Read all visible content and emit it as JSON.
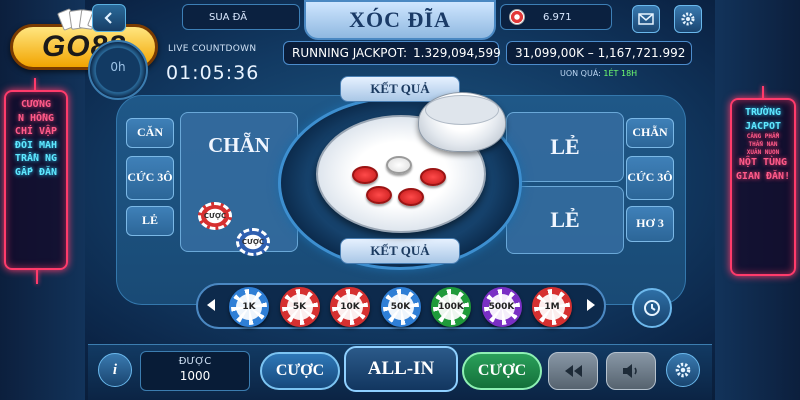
{
  "logo": {
    "text": "GO88"
  },
  "neon_left": {
    "lines": [
      "CƯƠNG",
      "N HỒNG",
      "CHÍ VẬP",
      "ĐÔI MAH",
      "TRẦN NG",
      "GẤP ĐĂN"
    ]
  },
  "neon_right": {
    "lines": [
      "TRƯỜNG",
      "JACPOT",
      "CĂNG PHẨM",
      "THẤN NAN",
      "XUÂN NUON",
      "NỘT TÙNG",
      "GIAN ĐĂN!"
    ]
  },
  "header": {
    "back_icon": "chevron-left-icon",
    "user_label": "SUA ĐÃ",
    "title": "XÓC ĐĨA",
    "balance": "6.971",
    "mail_icon": "mail-icon",
    "settings_icon": "gear-icon"
  },
  "countdown": {
    "ring_text": "0h",
    "label": "LIVE COUNTDOWN",
    "time": "01:05:36"
  },
  "jackpot": {
    "running_label": "RUNNING JACKPOT:",
    "running_value": "1.329,094,599",
    "second_value": "31,099,00K – 1,167,721.992",
    "uon_label": "UON QUÁ:",
    "uon_value": "1ÉT 18H"
  },
  "table": {
    "left_main": "CHẴN",
    "right_main_top": "LẺ",
    "right_main_bottom": "LẺ",
    "left_cells": [
      "CĂN",
      "CỨC 3Ô",
      "LẺ"
    ],
    "right_cells": [
      "CHẴN",
      "CỨC 3Ô",
      "HƠ 3"
    ],
    "result_top": "KẾT QUẢ",
    "result_bottom": "KẾT QUẢ",
    "bet_chip_1": "CƯỢC",
    "bet_chip_2": "CƯỢC"
  },
  "chips": [
    {
      "label": "1K",
      "color": "#2f7fd6"
    },
    {
      "label": "5K",
      "color": "#d63030"
    },
    {
      "label": "10K",
      "color": "#d63030"
    },
    {
      "label": "50K",
      "color": "#2f7fd6"
    },
    {
      "label": "100K",
      "color": "#1f9a3a"
    },
    {
      "label": "500K",
      "color": "#7a2fc4"
    },
    {
      "label": "1M",
      "color": "#d63030"
    }
  ],
  "bottom": {
    "info_label": "i",
    "duoc_label": "ĐƯỢC",
    "duoc_value": "1000",
    "cuoc_left": "CƯỢC",
    "allin": "ALL-IN",
    "cuoc_right": "CƯỢC",
    "rewind_icon": "rewind-icon",
    "sound_icon": "speaker-icon",
    "settings_icon": "gear-icon"
  },
  "colors": {
    "accent": "#3d8fd0",
    "allin_green": "#1f8a4a",
    "neon_pink": "#ff3b6b",
    "neon_cyan": "#5fe8ff"
  }
}
